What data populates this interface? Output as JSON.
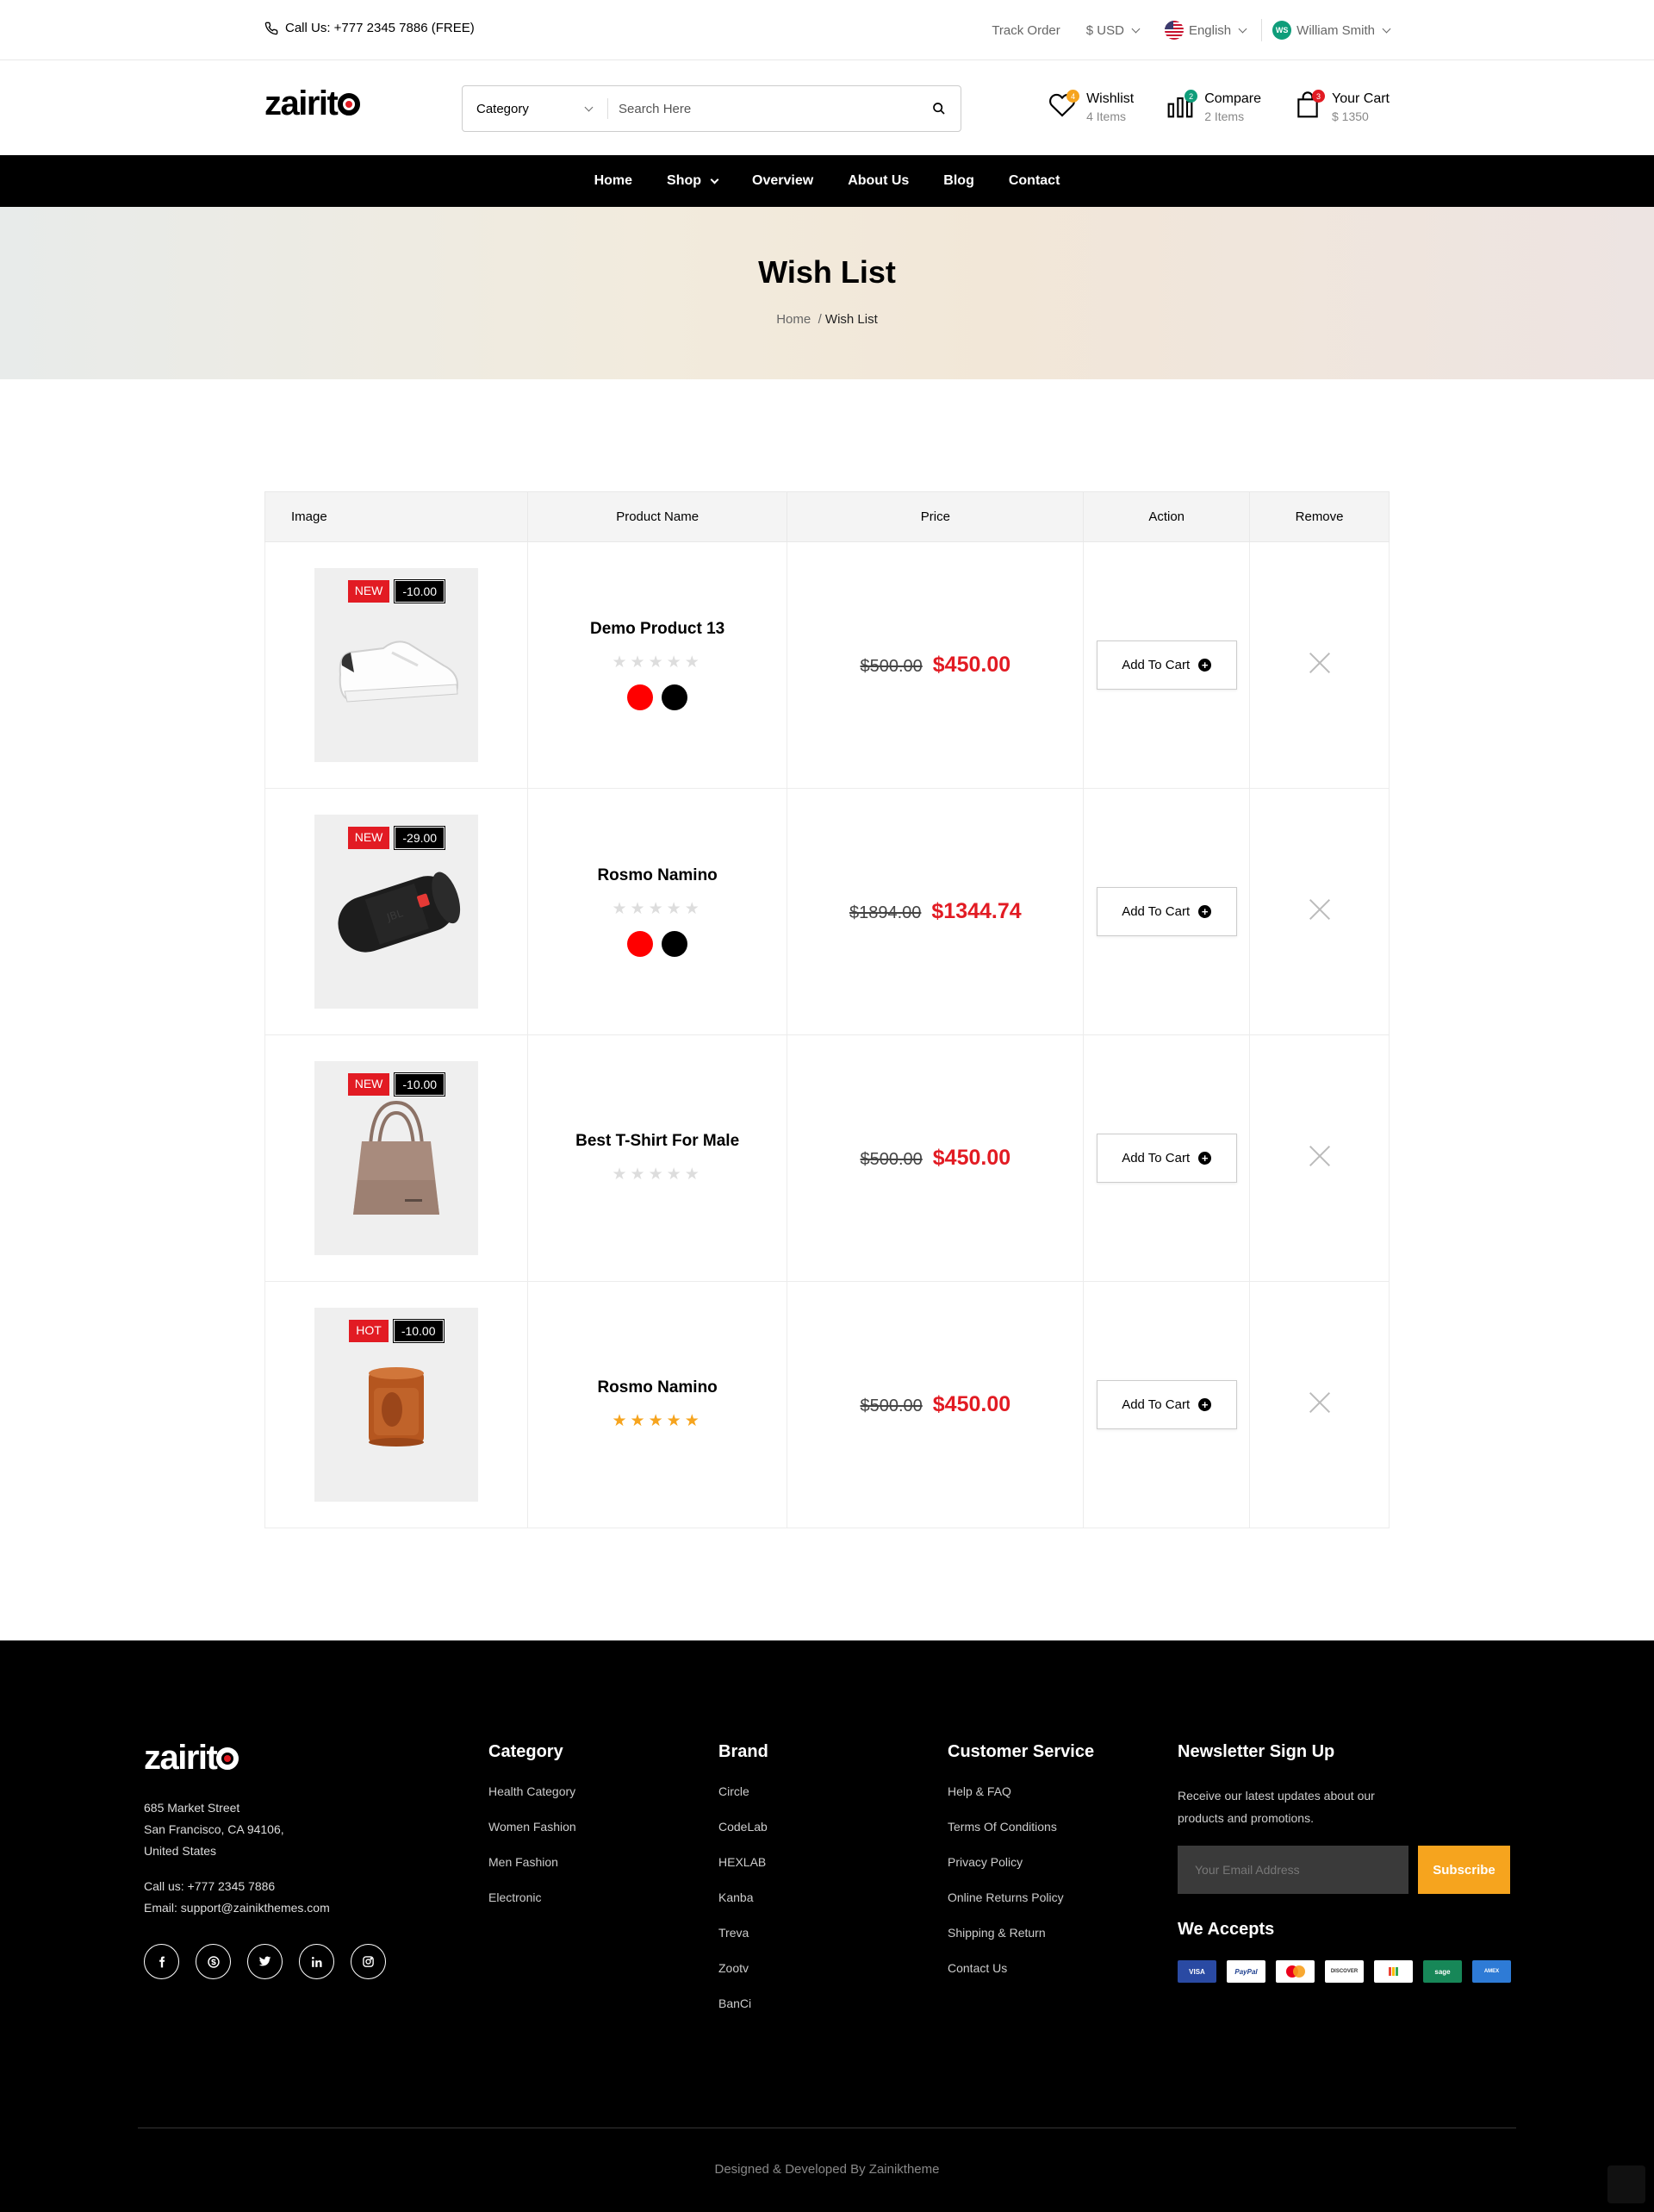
{
  "topbar": {
    "call": "Call Us: +777 2345 7886 (FREE)",
    "track": "Track Order",
    "currency": "$ USD",
    "language": "English",
    "user_initials": "WS",
    "user": "William Smith"
  },
  "header": {
    "logo": "zairit",
    "category_label": "Category",
    "search_placeholder": "Search Here",
    "wishlist": {
      "label": "Wishlist",
      "sub": "4 Items",
      "count": "4"
    },
    "compare": {
      "label": "Compare",
      "sub": "2 Items",
      "count": "2"
    },
    "cart": {
      "label": "Your Cart",
      "sub": "$ 1350",
      "count": "3"
    }
  },
  "nav": [
    "Home",
    "Shop",
    "Overview",
    "About Us",
    "Blog",
    "Contact"
  ],
  "banner": {
    "title": "Wish List",
    "crumb_home": "Home",
    "crumb_current": "Wish List"
  },
  "table": {
    "headers": [
      "Image",
      "Product Name",
      "Price",
      "Action",
      "Remove"
    ],
    "rows": [
      {
        "badge": "NEW",
        "discount": "-10.00",
        "name": "Demo Product 13",
        "rating": 0,
        "colors": [
          "#ff0000",
          "#000000"
        ],
        "old_price": "$500.00",
        "price": "$450.00",
        "action": "Add To Cart",
        "image": "sneaker"
      },
      {
        "badge": "NEW",
        "discount": "-29.00",
        "name": "Rosmo Namino",
        "rating": 0,
        "colors": [
          "#ff0000",
          "#000000"
        ],
        "old_price": "$1894.00",
        "price": "$1344.74",
        "action": "Add To Cart",
        "image": "speaker"
      },
      {
        "badge": "NEW",
        "discount": "-10.00",
        "name": "Best T-Shirt For Male",
        "rating": 0,
        "colors": [],
        "old_price": "$500.00",
        "price": "$450.00",
        "action": "Add To Cart",
        "image": "handbag"
      },
      {
        "badge": "HOT",
        "discount": "-10.00",
        "name": "Rosmo Namino",
        "rating": 5,
        "colors": [],
        "old_price": "$500.00",
        "price": "$450.00",
        "action": "Add To Cart",
        "image": "candle"
      }
    ]
  },
  "footer": {
    "logo": "zairit",
    "address": [
      "685 Market Street",
      "San Francisco, CA 94106,",
      "United States"
    ],
    "phone": "Call us: +777 2345 7886",
    "email": "Email: support@zainikthemes.com",
    "social": [
      "facebook-icon",
      "skype-icon",
      "twitter-icon",
      "linkedin-icon",
      "instagram-icon"
    ],
    "category": {
      "title": "Category",
      "links": [
        "Health Category",
        "Women Fashion",
        "Men Fashion",
        "Electronic"
      ]
    },
    "brand": {
      "title": "Brand",
      "links": [
        "Circle",
        "CodeLab",
        "HEXLAB",
        "Kanba",
        "Treva",
        "Zootv",
        "BanCi"
      ]
    },
    "service": {
      "title": "Customer Service",
      "links": [
        "Help & FAQ",
        "Terms Of Conditions",
        "Privacy Policy",
        "Online Returns Policy",
        "Shipping & Return",
        "Contact Us"
      ]
    },
    "newsletter": {
      "title": "Newsletter Sign Up",
      "text": "Receive our latest updates about our products and promotions.",
      "placeholder": "Your Email Address",
      "button": "Subscribe",
      "accepts": "We Accepts"
    },
    "cards": [
      "VISA",
      "PayPal",
      "mastercard",
      "DISCOVER",
      "google",
      "sage",
      "AMEX"
    ],
    "copyright": "Designed & Developed By Zainiktheme"
  },
  "colors": {
    "accent": "#e21b23",
    "gold": "#f6a41e",
    "nav_bg": "#000000"
  }
}
